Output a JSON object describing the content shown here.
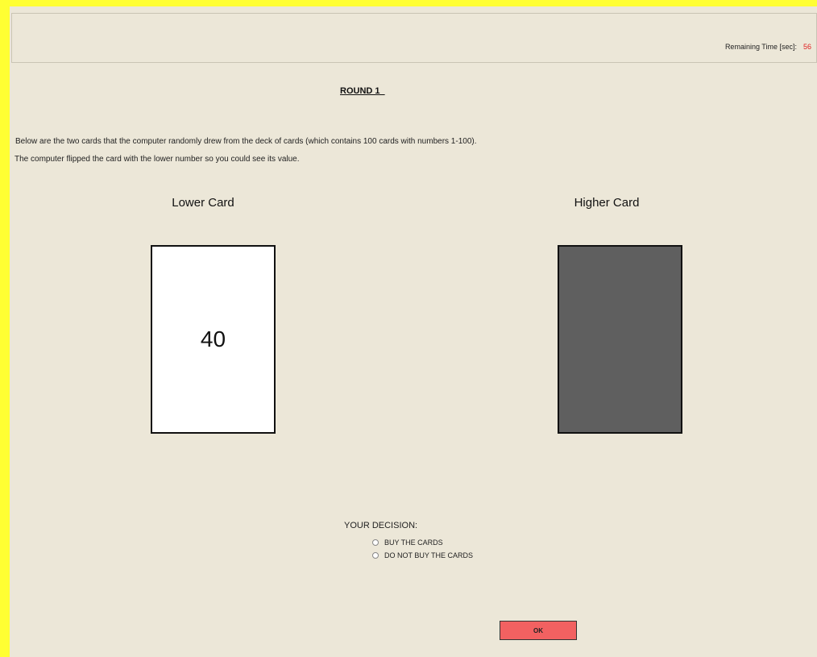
{
  "header": {
    "timer_label": "Remaining Time [sec]:",
    "timer_value": "56"
  },
  "round_title": "ROUND 1  ",
  "instructions": [
    "Below are the two cards that the computer randomly drew from the deck of cards (which contains 100 cards with numbers 1-100).",
    "The computer flipped the card with the lower number so you could see its value."
  ],
  "cards": {
    "lower": {
      "title": "Lower Card",
      "value": "40"
    },
    "higher": {
      "title": "Higher Card"
    }
  },
  "decision": {
    "label": "YOUR DECISION:",
    "options": [
      "BUY  THE  CARDS",
      "DO NOT BUY THE  CARDS"
    ]
  },
  "ok_button": "OK",
  "colors": {
    "frame": "#ffff33",
    "background": "#ece7d8",
    "card_back": "#5f5f5f",
    "timer_value": "#e02020",
    "ok_button": "#f26161"
  }
}
